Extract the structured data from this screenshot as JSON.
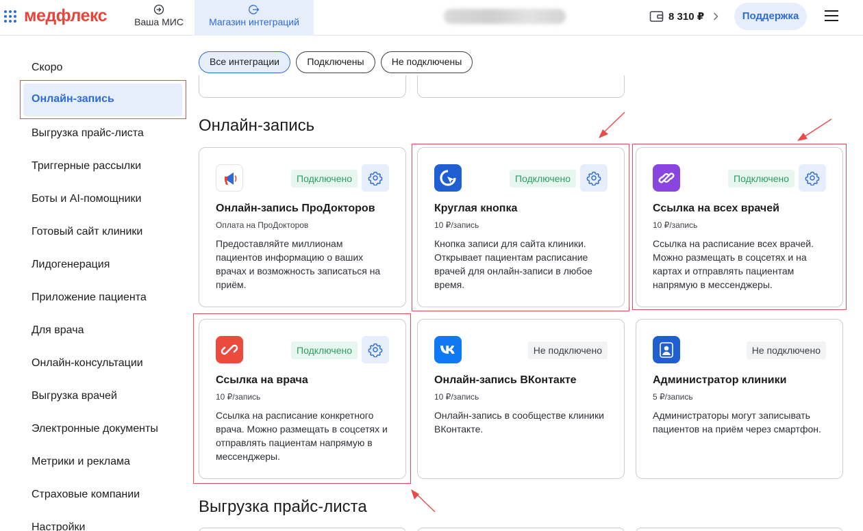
{
  "header": {
    "logo": "медфлекс",
    "tabs": [
      {
        "label": "Ваша МИС"
      },
      {
        "label": "Магазин интеграций"
      }
    ],
    "balance": "8 310 ₽",
    "support_label": "Поддержка"
  },
  "sidebar": {
    "items": [
      {
        "label": "Скоро"
      },
      {
        "label": "Онлайн-запись"
      },
      {
        "label": "Выгрузка прайс-листа"
      },
      {
        "label": "Триггерные рассылки"
      },
      {
        "label": "Боты и AI-помощники"
      },
      {
        "label": "Готовый сайт клиники"
      },
      {
        "label": "Лидогенерация"
      },
      {
        "label": "Приложение пациента"
      },
      {
        "label": "Для врача"
      },
      {
        "label": "Онлайн-консультации"
      },
      {
        "label": "Выгрузка врачей"
      },
      {
        "label": "Электронные документы"
      },
      {
        "label": "Метрики и реклама"
      },
      {
        "label": "Страховые компании"
      },
      {
        "label": "Настройки"
      }
    ],
    "active": "Онлайн-запись"
  },
  "filters": {
    "all": "Все интеграции",
    "connected": "Подключены",
    "not_connected": "Не подключены",
    "selected": "Все интеграции"
  },
  "sections": {
    "online_booking": "Онлайн-запись",
    "price_export": "Выгрузка прайс-листа"
  },
  "cards": [
    {
      "title": "Онлайн-запись ПроДокторов",
      "price": "Оплата на ПроДокторов",
      "status": "Подключено",
      "desc": "Предоставляйте миллионам пациентов информацию о ваших врачах и возможность записаться на приём.",
      "icon": "megaphone-icon"
    },
    {
      "title": "Круглая кнопка",
      "price": "10 ₽/запись",
      "status": "Подключено",
      "desc": "Кнопка записи для сайта клиники. Открывает пациентам расписание врачей для онлайн-записи в любое время.",
      "icon": "cursor-icon"
    },
    {
      "title": "Ссылка на всех врачей",
      "price": "10 ₽/запись",
      "status": "Подключено",
      "desc": "Ссылка на расписание всех врачей. Можно размещать в соцсетях и на картах и отправлять пациентам напрямую в мессенджеры.",
      "icon": "double-link-icon"
    },
    {
      "title": "Ссылка на врача",
      "price": "10 ₽/запись",
      "status": "Подключено",
      "desc": "Ссылка на расписание конкретного врача. Можно размещать в соцсетях и отправлять пациентам напрямую в мессенджеры.",
      "icon": "link-icon"
    },
    {
      "title": "Онлайн-запись ВКонтакте",
      "price": "10 ₽/запись",
      "status": "Не подключено",
      "desc": "Онлайн-запись в сообществе клиники ВКонтакте.",
      "icon": "vk-icon"
    },
    {
      "title": "Администратор клиники",
      "price": "5 ₽/запись",
      "status": "Не подключено",
      "desc": "Администраторы могут записывать пациентов на приём через смартфон.",
      "icon": "admin-user-icon"
    }
  ],
  "colors": {
    "brand_red": "#e9443a",
    "brand_blue": "#2e6bd8",
    "connected_green": "#2c9d62",
    "annotation_red": "#e94a4a"
  }
}
